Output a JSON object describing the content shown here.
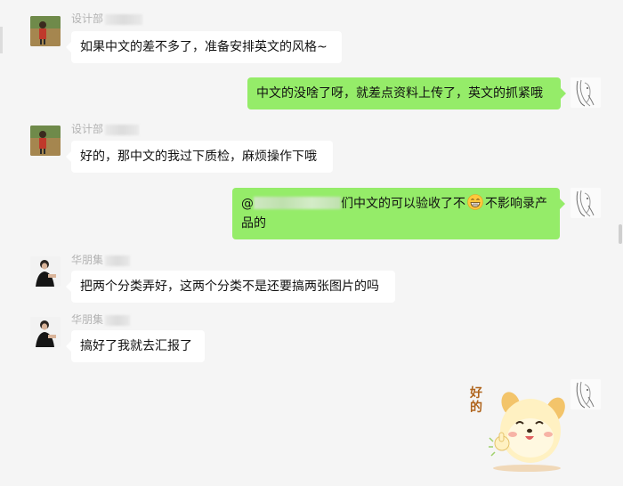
{
  "messages": [
    {
      "id": "m1",
      "side": "in",
      "sender": "设计部",
      "text": "如果中文的差不多了，准备安排英文的风格~"
    },
    {
      "id": "m2",
      "side": "out",
      "text": "中文的没啥了呀，就差点资料上传了，英文的抓紧哦"
    },
    {
      "id": "m3",
      "side": "in",
      "sender": "设计部",
      "text": "好的，那中文的我过下质检，麻烦操作下哦"
    },
    {
      "id": "m4",
      "side": "out",
      "prefix": "@",
      "text_after": "们中文的可以验收了不",
      "text_tail": "不影响录产品的"
    },
    {
      "id": "m5",
      "side": "in",
      "sender": "华朋集",
      "text": "把两个分类弄好，这两个分类不是还要搞两张图片的吗"
    },
    {
      "id": "m6",
      "side": "in",
      "sender": "华朋集",
      "text": "搞好了我就去汇报了"
    }
  ],
  "sticker": {
    "text": "好的",
    "icon": "dog-thumbs-up-sticker"
  },
  "colors": {
    "background": "#f5f5f5",
    "outgoing": "#95ec69",
    "incoming": "#ffffff",
    "sender": "#b2b2b2"
  }
}
